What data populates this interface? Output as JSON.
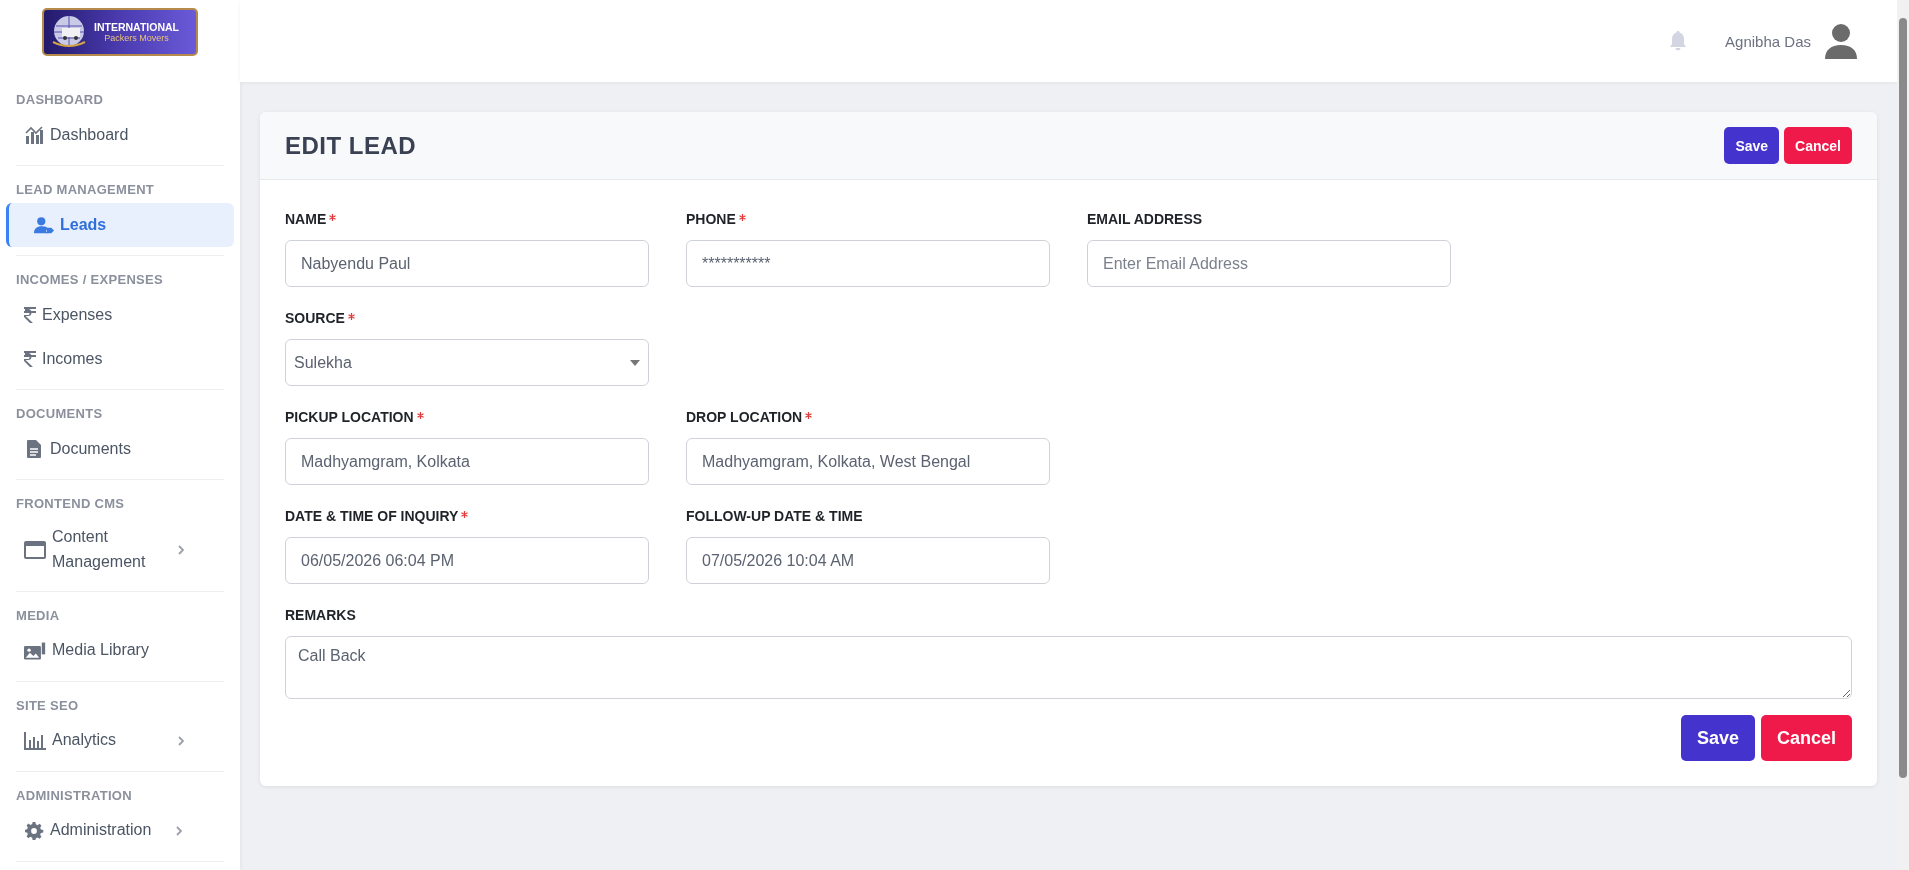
{
  "sidebar": {
    "logo": {
      "line_1": "INTERNATIONAL",
      "line_2": "Packers Movers"
    },
    "sections": [
      {
        "heading": "DASHBOARD",
        "items": [
          {
            "label": "Dashboard",
            "selected": false,
            "expandable": false
          }
        ]
      },
      {
        "heading": "LEAD MANAGEMENT",
        "items": [
          {
            "label": "Leads",
            "selected": true,
            "expandable": false
          }
        ]
      },
      {
        "heading": "INCOMES / EXPENSES",
        "items": [
          {
            "label": "Expenses",
            "selected": false,
            "expandable": false
          },
          {
            "label": "Incomes",
            "selected": false,
            "expandable": false
          }
        ]
      },
      {
        "heading": "DOCUMENTS",
        "items": [
          {
            "label": "Documents",
            "selected": false,
            "expandable": false
          }
        ]
      },
      {
        "heading": "FRONTEND CMS",
        "items": [
          {
            "label": "Content Management",
            "selected": false,
            "expandable": true
          }
        ]
      },
      {
        "heading": "MEDIA",
        "items": [
          {
            "label": "Media Library",
            "selected": false,
            "expandable": false
          }
        ]
      },
      {
        "heading": "SITE SEO",
        "items": [
          {
            "label": "Analytics",
            "selected": false,
            "expandable": true
          }
        ]
      },
      {
        "heading": "ADMINISTRATION",
        "items": [
          {
            "label": "Administration",
            "selected": false,
            "expandable": true
          }
        ]
      }
    ]
  },
  "header": {
    "user_name": "Agnibha Das"
  },
  "card": {
    "title": "EDIT LEAD",
    "buttons": [
      {
        "label": "Save",
        "kind": "primary"
      },
      {
        "label": "Cancel",
        "kind": "danger"
      }
    ],
    "rows": [
      [
        {
          "label": "NAME",
          "required": true,
          "kind": "text",
          "value": "Nabyendu Paul"
        },
        {
          "label": "PHONE",
          "required": true,
          "kind": "text",
          "value": "***********"
        },
        {
          "label": "EMAIL ADDRESS",
          "required": false,
          "kind": "text",
          "placeholder": "Enter Email Address"
        }
      ],
      [
        {
          "label": "SOURCE",
          "required": true,
          "kind": "select",
          "value": "Sulekha"
        }
      ],
      [
        {
          "label": "PICKUP LOCATION",
          "required": true,
          "kind": "text",
          "value": "Madhyamgram, Kolkata"
        },
        {
          "label": "DROP LOCATION",
          "required": true,
          "kind": "text",
          "value": "Madhyamgram, Kolkata, West Bengal"
        }
      ],
      [
        {
          "label": "DATE & TIME OF INQUIRY",
          "required": true,
          "kind": "text",
          "value": "06/05/2026 06:04 PM"
        },
        {
          "label": "FOLLOW-UP DATE & TIME",
          "required": false,
          "kind": "text",
          "value": "07/05/2026 10:04 AM"
        }
      ],
      [
        {
          "label": "REMARKS",
          "required": false,
          "kind": "textarea",
          "value": "Call Back"
        }
      ]
    ],
    "footer_buttons": [
      {
        "label": "Save",
        "kind": "primary"
      },
      {
        "label": "Cancel",
        "kind": "danger"
      }
    ]
  }
}
